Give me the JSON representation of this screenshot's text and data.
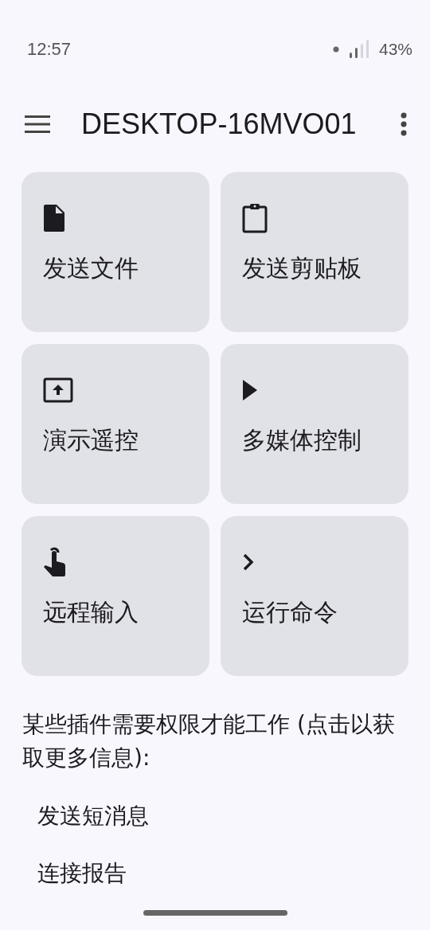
{
  "status_bar": {
    "time": "12:57",
    "battery": "43%"
  },
  "toolbar": {
    "title": "DESKTOP-16MVO01"
  },
  "actions": [
    {
      "label": "发送文件"
    },
    {
      "label": "发送剪贴板"
    },
    {
      "label": "演示遥控"
    },
    {
      "label": "多媒体控制"
    },
    {
      "label": "远程输入"
    },
    {
      "label": "运行命令"
    }
  ],
  "permissions": {
    "note": "某些插件需要权限才能工作 (点击以获取更多信息):",
    "items": [
      "发送短消息",
      "连接报告"
    ]
  }
}
